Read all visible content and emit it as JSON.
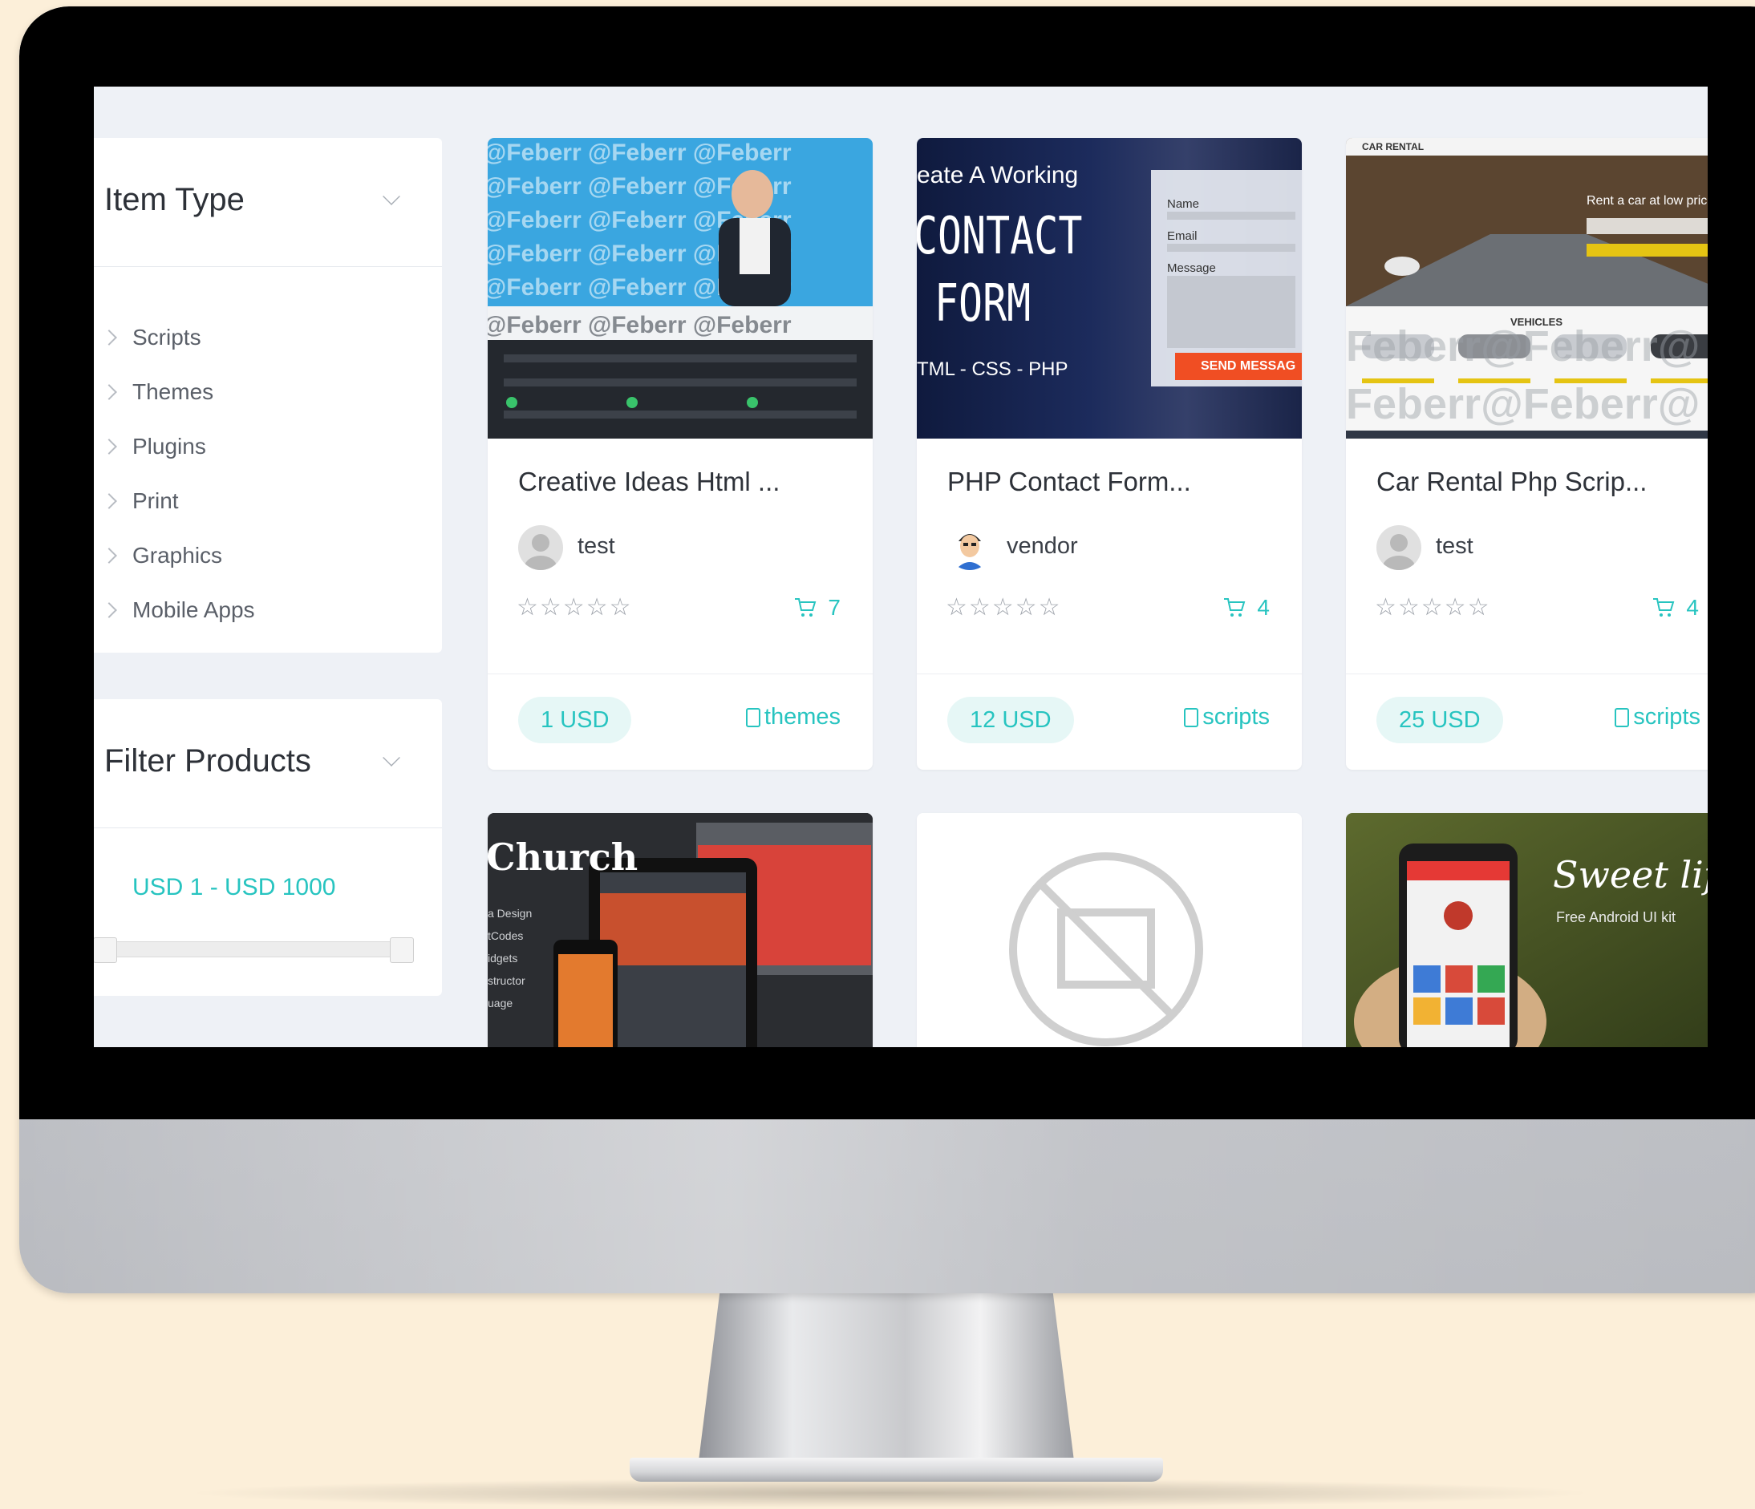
{
  "sidebar": {
    "item_type": {
      "title": "Item Type",
      "items": [
        "Scripts",
        "Themes",
        "Plugins",
        "Print",
        "Graphics",
        "Mobile Apps"
      ]
    },
    "filter": {
      "title": "Filter Products",
      "price_range": "USD 1 - USD 1000",
      "min": 1,
      "max": 1000
    }
  },
  "thumbnails": {
    "contact": {
      "line1": "eate A Working",
      "line2": "CONTACT",
      "line3": "FORM",
      "line4": "TML - CSS - PHP",
      "field_name": "Name",
      "field_email": "Email",
      "field_message": "Message",
      "send": "SEND MESSAG"
    },
    "car": {
      "brand": "CAR RENTAL",
      "tagline": "Rent a car at low pric",
      "vehicles": "VEHICLES"
    },
    "church": {
      "title": "Church"
    },
    "sweet": {
      "title": "Sweet life",
      "subtitle": "Free Android UI kit"
    }
  },
  "products": [
    {
      "title": "Creative Ideas Html ...",
      "author": "test",
      "sales": "7",
      "price": "1 USD",
      "category": "themes",
      "avatar": "placeholder"
    },
    {
      "title": "PHP Contact Form...",
      "author": "vendor",
      "sales": "4",
      "price": "12 USD",
      "category": "scripts",
      "avatar": "cartoon"
    },
    {
      "title": "Car Rental Php Scrip...",
      "author": "test",
      "sales": "4",
      "price": "25 USD",
      "category": "scripts",
      "avatar": "placeholder"
    }
  ],
  "colors": {
    "accent": "#27c4c0",
    "screen_bg": "#eef1f6"
  }
}
